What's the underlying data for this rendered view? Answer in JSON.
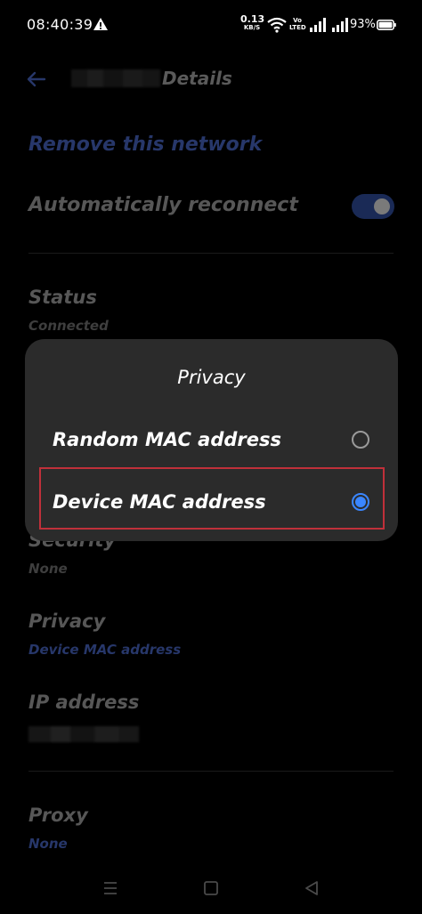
{
  "status_bar": {
    "time": "08:40:39",
    "net_speed_value": "0.13",
    "net_speed_unit": "KB/S",
    "volte_top": "Vo",
    "volte_bottom": "LTED",
    "battery": "93%",
    "icons": [
      "alert-icon",
      "wifi-icon",
      "signal-icon",
      "battery-icon"
    ]
  },
  "app_bar": {
    "title": "Details",
    "back_icon": "arrow-left-icon"
  },
  "content": {
    "remove_link": "Remove this network",
    "auto_reconnect_label": "Automatically reconnect",
    "auto_reconnect_on": true,
    "status_label": "Status",
    "status_value": "Connected",
    "security_label": "Security",
    "security_value": "None",
    "privacy_label": "Privacy",
    "privacy_value": "Device MAC address",
    "ip_label": "IP address",
    "proxy_label": "Proxy",
    "proxy_value": "None"
  },
  "dialog": {
    "title": "Privacy",
    "options": [
      {
        "label": "Random MAC address",
        "selected": false
      },
      {
        "label": "Device MAC address",
        "selected": true
      }
    ]
  },
  "nav_bar": {
    "icons": [
      "menu-icon",
      "home-square-icon",
      "back-triangle-icon"
    ]
  },
  "colors": {
    "accent": "#3a86ff",
    "highlight_box": "#c0303a",
    "dialog_bg": "#2b2b2b"
  }
}
